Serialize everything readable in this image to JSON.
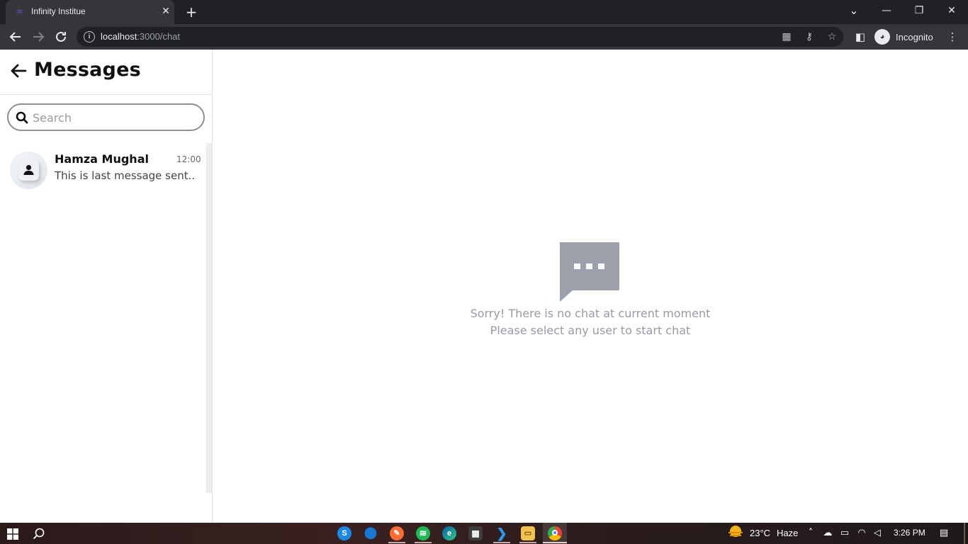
{
  "browser": {
    "tab_title": "Infinity Institue",
    "tab_favicon": "∞",
    "new_tab_symbol": "+",
    "close_symbol": "✕",
    "url_host": "localhost",
    "url_path": ":3000/chat",
    "profile_label": "Incognito",
    "window_controls": {
      "chevron": "⌄",
      "minimize": "—",
      "restore": "❐",
      "close": "✕"
    }
  },
  "sidebar": {
    "title": "Messages",
    "search_placeholder": "Search",
    "search_value": "",
    "chats": [
      {
        "name": "Hamza Mughal",
        "time": "12:00",
        "last_message": "This is last message sent..."
      }
    ]
  },
  "main": {
    "empty_line1": "Sorry! There is no chat at current moment",
    "empty_line2": "Please select any user to start chat",
    "empty_icon": "chat-bubble-dots-icon",
    "empty_icon_color": "#9ca0ab"
  },
  "taskbar": {
    "weather_temp": "23°C",
    "weather_label": "Haze",
    "clock": "3:26 PM"
  },
  "colors": {
    "accent_dark": "#111111",
    "muted_text": "#9a9aa3",
    "chrome_bg": "#202124"
  }
}
